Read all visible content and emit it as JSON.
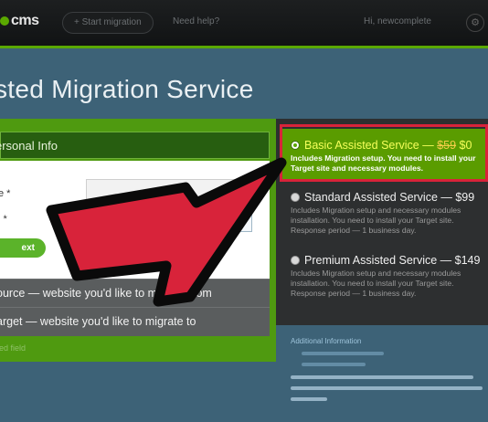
{
  "topbar": {
    "logo": "cms",
    "start_migration": "+ Start migration",
    "need_help": "Need help?",
    "nav_right": "Hi, newcomplete"
  },
  "page": {
    "title": "sted Migration Service"
  },
  "form": {
    "section_title": "ersonal Info",
    "label_1": "e *",
    "label_2": "l *",
    "next_label": "ext",
    "source_step": "ource — website you'd like to migrate from",
    "target_step": "arget — website you'd like to migrate to",
    "required_note": "ired field"
  },
  "options": [
    {
      "title": "Basic Assisted Service —",
      "old_price": "$59",
      "price": "$0",
      "desc": "Includes Migration setup. You need to install your Target site and necessary modules.",
      "selected": true
    },
    {
      "title": "Standard Assisted Service — $99",
      "desc": "Includes Migration setup and necessary modules installation. You need to install your Target site. Response period — 1 business day.",
      "selected": false
    },
    {
      "title": "Premium Assisted Service — $149",
      "desc": "Includes Migration setup and necessary modules installation. You need to install your Target site. Response period — 1 business day.",
      "selected": false
    }
  ],
  "info": {
    "title": "Additional Information"
  },
  "colors": {
    "accent_green": "#5aa800",
    "annotation_red": "#d8233a",
    "page_blue": "#3d6277"
  }
}
